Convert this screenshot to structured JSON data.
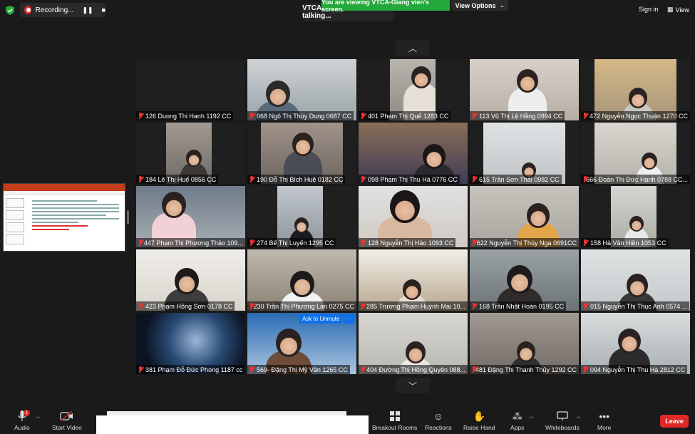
{
  "recording": {
    "label": "Recording..."
  },
  "banner": {
    "viewing": "You are viewing VTCA-Giang vien's screen",
    "view_options": "View Options"
  },
  "talking": "VTCA-Giang vien is talking...",
  "header": {
    "sign_in": "Sign in",
    "view": "View"
  },
  "tiles": [
    {
      "label": "126 Duong Thi Hanh 1192 CC"
    },
    {
      "label": "068 Ngô Thị Thùy Dung 0687 CC"
    },
    {
      "label": "401 Phạm Thị Quế 1283 CC"
    },
    {
      "label": "113 Vũ Thị Lệ Hằng 0994 CC"
    },
    {
      "label": "472 Nguyễn Ngọc Thuận 1270 CC"
    },
    {
      "label": "184 Lê Thị Huế 0856 CC"
    },
    {
      "label": "190 Đỗ Thị Bích Huệ 0182 CC"
    },
    {
      "label": "098 Phạm Thị Thu Hà 0776 CC"
    },
    {
      "label": "615 Trần Sơn Thái 0982 CC"
    },
    {
      "label": "666 Đoàn Thị Đức Hạnh 0788 CC..."
    },
    {
      "label": "447 Phạm Thị Phương Thảo 109..."
    },
    {
      "label": "274 Bế Thị Luyến 1295 CC"
    },
    {
      "label": "128 Nguyễn Thị Hảo 1093 CC"
    },
    {
      "label": "622 Nguyễn Thị Thúy Nga 0691CC"
    },
    {
      "label": "158 Hà Văn Hiền 1053 CC"
    },
    {
      "label": "423 Phạm Hồng Sơn 0178 CC"
    },
    {
      "label": "230 Trần Thị Phương Lan 0275 CC"
    },
    {
      "label": "285 Trương Phạm Huỳnh Mai 10..."
    },
    {
      "label": "168 Trần Nhật Hoàn 0195 CC"
    },
    {
      "label": "015 Nguyễn Thị Thục Anh 0574 ..."
    },
    {
      "label": "381 Phạm Đỗ Đức Phong 1187 cc"
    },
    {
      "label": "569- Đặng Thị Mỹ Vân 1265 CC"
    },
    {
      "label": "404 Đường Thị Hồng Quyên 088..."
    },
    {
      "label": "481 Đặng Thị Thanh Thủy 1292 CC"
    },
    {
      "label": "094 Nguyễn Thị Thu Hà 2812 CC"
    }
  ],
  "tile_overlay": {
    "ask_to_unmute": "Ask to Unmute",
    "more": "···"
  },
  "toolbar": {
    "audio": "Audio",
    "audio_badge": "1",
    "start_video": "Start Video",
    "breakout": "Breakout Rooms",
    "reactions": "Reactions",
    "raise_hand": "Raise Hand",
    "apps": "Apps",
    "whiteboards": "Whiteboards",
    "more": "More",
    "leave": "Leave"
  },
  "colors": {
    "accent_green": "#24a83b",
    "leave_red": "#e02828",
    "unmute_blue": "#0e71eb"
  }
}
